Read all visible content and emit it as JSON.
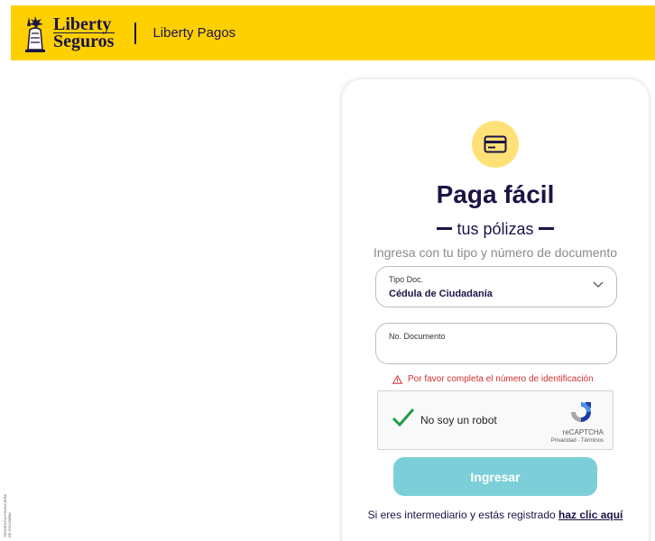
{
  "header": {
    "logo_line1": "Liberty",
    "logo_line2": "Seguros",
    "title": "Liberty Pagos",
    "logo_icon": "statue-of-liberty-icon"
  },
  "card": {
    "icon": "credit-card-icon",
    "title": "Paga fácil",
    "subtitle": "tus pólizas",
    "hint": "Ingresa con tu tipo y número de documento",
    "doc_type": {
      "label": "Tipo Doc.",
      "value": "Cédula de Ciudadanía"
    },
    "doc_number": {
      "label": "No. Documento",
      "value": ""
    },
    "error": "Por favor completa el número de identificación",
    "recaptcha": {
      "label": "No soy un robot",
      "brand": "reCAPTCHA",
      "links": "Privacidad - Términos"
    },
    "submit_label": "Ingresar",
    "footer_text": "Si eres intermediario y estás registrado ",
    "footer_link": "haz clic aquí"
  },
  "side_note": {
    "line1": "TENDENCIA FINANCIERA",
    "line2": "DE COLOMBIA"
  },
  "colors": {
    "brand_yellow": "#ffd000",
    "brand_navy": "#1a1446",
    "button_teal": "#7ccfd8",
    "error_red": "#d32f2f"
  }
}
